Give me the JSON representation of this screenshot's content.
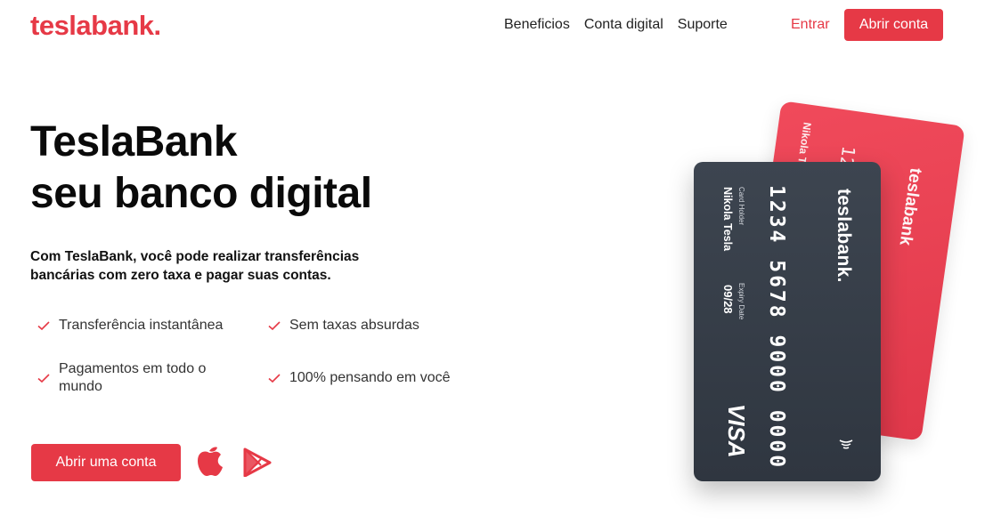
{
  "brand": {
    "logo": "teslabank.",
    "color": "#e63946"
  },
  "nav": {
    "items": [
      {
        "label": "Beneficios"
      },
      {
        "label": "Conta digital"
      },
      {
        "label": "Suporte"
      }
    ],
    "enter_label": "Entrar",
    "open_account_label": "Abrir conta"
  },
  "hero": {
    "title_line1": "TeslaBank",
    "title_line2": "seu banco digital",
    "description": "Com TeslaBank, você pode realizar transferências bancárias com zero taxa e pagar suas contas.",
    "features": [
      {
        "label": "Transferência instantânea"
      },
      {
        "label": "Sem taxas absurdas"
      },
      {
        "label": "Pagamentos em todo o mundo"
      },
      {
        "label": "100% pensando em você"
      }
    ],
    "cta_label": "Abrir uma conta",
    "store_icons": [
      "apple-icon",
      "google-play-icon"
    ]
  },
  "cards": {
    "back": {
      "brand": "teslabank",
      "holder": "Nikola Tesla",
      "number": "1234"
    },
    "front": {
      "brand": "teslabank.",
      "number": "1234 5678 9000 0000",
      "holder_label": "Card Holder",
      "holder": "Nikola Tesla",
      "expiry_label": "Expiry Date",
      "expiry": "09/28",
      "network": "VISA"
    }
  }
}
